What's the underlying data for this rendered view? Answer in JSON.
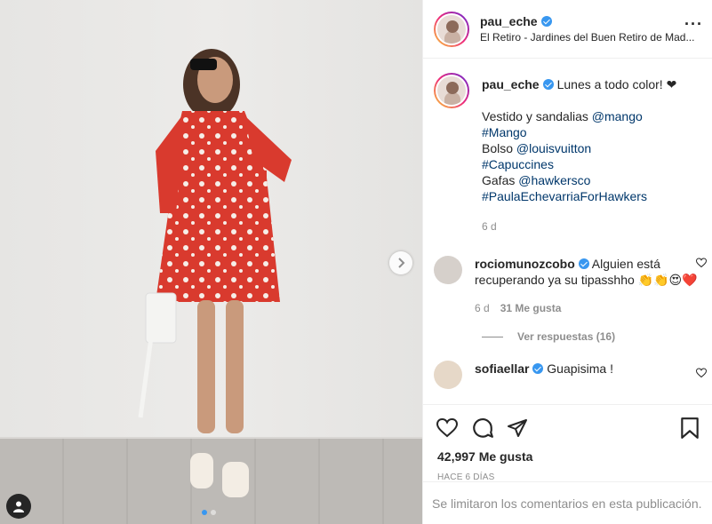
{
  "post": {
    "username": "pau_eche",
    "location": "El Retiro - Jardines del Buen Retiro de Mad...",
    "carousel_total": 2,
    "carousel_active": 1
  },
  "caption": {
    "username": "pau_eche",
    "lines": [
      [
        {
          "text": "Lunes a todo color! ❤",
          "mention": false
        }
      ],
      [
        {
          "text": "",
          "mention": false
        }
      ],
      [
        {
          "text": "Vestido y sandalias ",
          "mention": false
        },
        {
          "text": "@mango",
          "mention": true
        }
      ],
      [
        {
          "text": "#Mango",
          "mention": true
        }
      ],
      [
        {
          "text": "Bolso ",
          "mention": false
        },
        {
          "text": "@louisvuitton",
          "mention": true
        }
      ],
      [
        {
          "text": "#Capuccines",
          "mention": true
        }
      ],
      [
        {
          "text": "Gafas ",
          "mention": false
        },
        {
          "text": "@hawkersco",
          "mention": true
        }
      ],
      [
        {
          "text": "#PaulaEchevarriaForHawkers",
          "mention": true
        }
      ]
    ],
    "time": "6 d"
  },
  "comments": [
    {
      "username": "rociomunozcobo",
      "text": "Alguien está recuperando ya su tipasshho 👏👏😍❤️",
      "time": "6 d",
      "likes": "31 Me gusta",
      "replies": "Ver respuestas (16)"
    },
    {
      "username": "sofiaellar",
      "text": "Guapisima !"
    }
  ],
  "likes_count": "42,997 Me gusta",
  "date": "HACE 6 DÍAS",
  "footer_text": "Se limitaron los comentarios en esta publicación.",
  "colors": {
    "accent": "#3897f0",
    "mention": "#00376b",
    "muted": "#8e8e8e",
    "text": "#262626"
  }
}
